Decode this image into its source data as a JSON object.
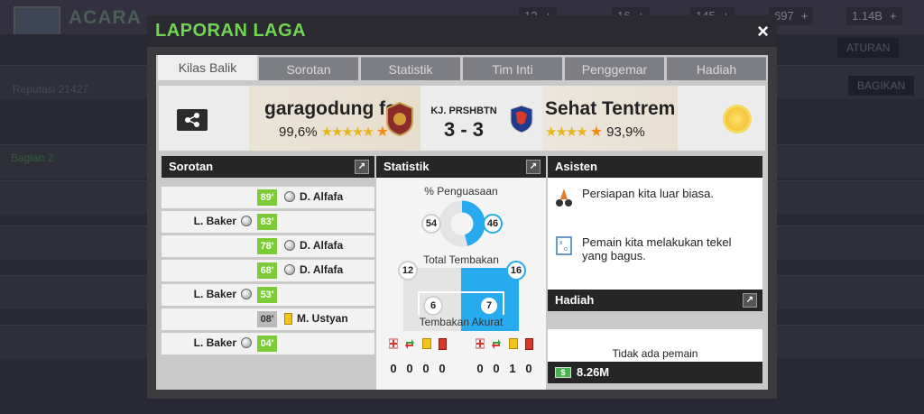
{
  "background": {
    "title": "ACARA",
    "resources": [
      "12",
      "16",
      "145",
      "697",
      "1.14B"
    ],
    "side_text": "Bagian 2",
    "side_label": "Reputasi 21427",
    "btn_right": "ATURAN",
    "btn_right2": "BAGIKAN"
  },
  "modal": {
    "title": "LAPORAN LAGA",
    "close_label": "×"
  },
  "tabs": [
    {
      "label": "Kilas Balik",
      "active": true
    },
    {
      "label": "Sorotan"
    },
    {
      "label": "Statistik"
    },
    {
      "label": "Tim Inti"
    },
    {
      "label": "Penggemar"
    },
    {
      "label": "Hadiah"
    }
  ],
  "match": {
    "home_name": "garagodung fc",
    "home_rating": "99,6%",
    "away_name": "Sehat Tentrem",
    "away_rating": "93,9%",
    "competition": "KJ. PRSHBTN",
    "score": "3 - 3",
    "home_stars": "★★★★★",
    "away_stars": "★★★★",
    "weather_icon": "sun-icon"
  },
  "highlights": {
    "header": "Sorotan",
    "events": [
      {
        "minute": "89'",
        "player": "D. Alfafa",
        "side": "right",
        "type": "goal",
        "color": "green"
      },
      {
        "minute": "83'",
        "player": "L. Baker",
        "side": "left",
        "type": "goal",
        "color": "green"
      },
      {
        "minute": "78'",
        "player": "D. Alfafa",
        "side": "right",
        "type": "goal",
        "color": "green"
      },
      {
        "minute": "68'",
        "player": "D. Alfafa",
        "side": "right",
        "type": "goal",
        "color": "green"
      },
      {
        "minute": "53'",
        "player": "L. Baker",
        "side": "left",
        "type": "goal",
        "color": "green"
      },
      {
        "minute": "08'",
        "player": "M. Ustyan",
        "side": "right",
        "type": "yellow-card",
        "color": "grey"
      },
      {
        "minute": "04'",
        "player": "L. Baker",
        "side": "left",
        "type": "goal",
        "color": "green"
      }
    ]
  },
  "stats": {
    "header": "Statistik",
    "possession_label": "% Penguasaan",
    "possession_home": "54",
    "possession_away": "46",
    "shots_label": "Total Tembakan",
    "shots_home": "12",
    "shots_away": "16",
    "on_target_home": "6",
    "on_target_away": "7",
    "on_target_label": "Tembakan Akurat",
    "home_counts": [
      "0",
      "0",
      "0",
      "0"
    ],
    "away_counts": [
      "0",
      "0",
      "1",
      "0"
    ],
    "colors": {
      "home": "#e4e4e4",
      "away": "#28aaee"
    }
  },
  "assistant": {
    "header": "Asisten",
    "messages": [
      {
        "icon": "training-cone-icon",
        "text": "Persiapan kita luar biasa."
      },
      {
        "icon": "tactics-board-icon",
        "text": "Pemain kita melakukan tekel yang bagus."
      }
    ]
  },
  "rewards": {
    "header": "Hadiah",
    "empty_text": "Tidak ada pemain",
    "cash": "8.26M"
  }
}
